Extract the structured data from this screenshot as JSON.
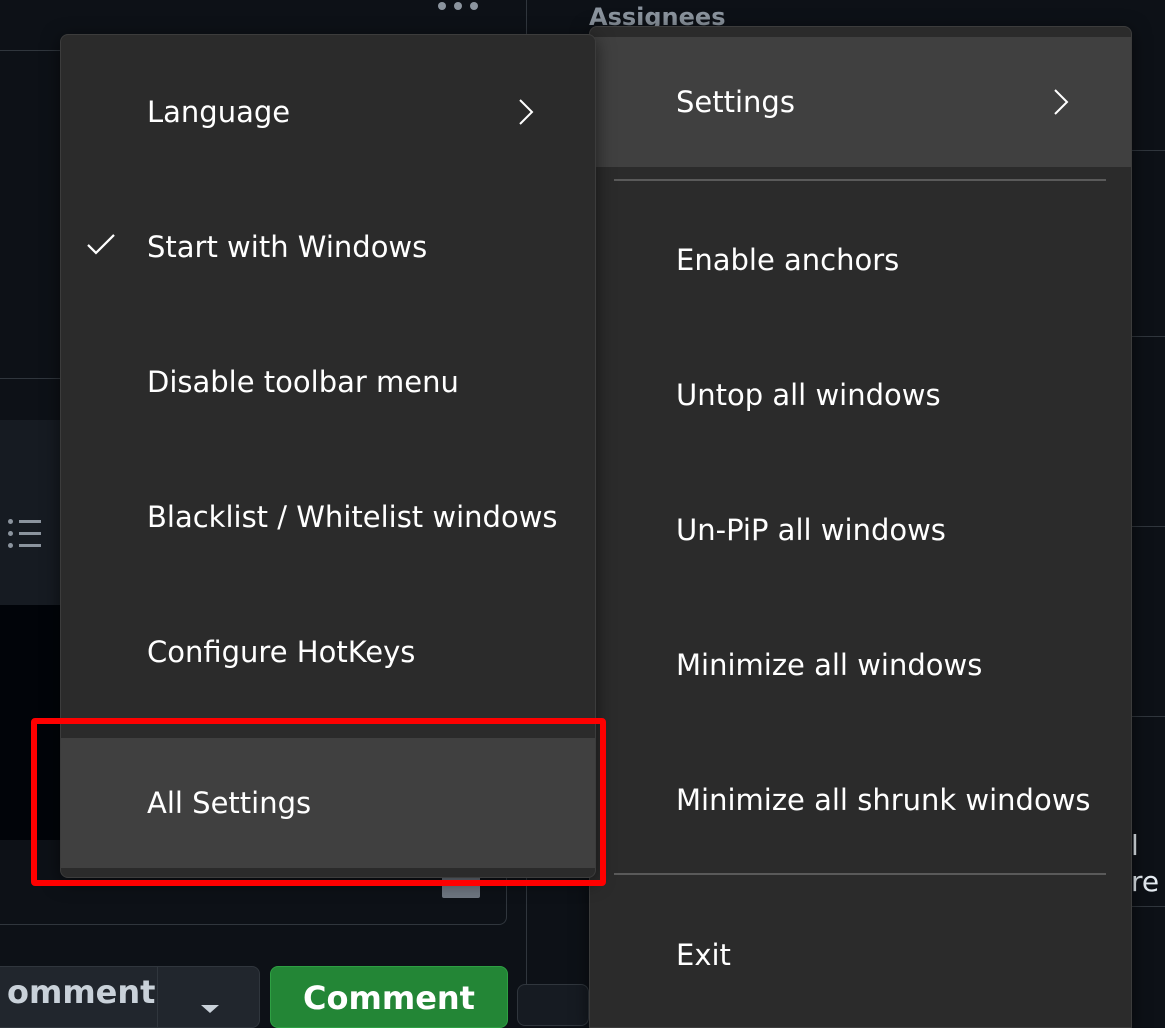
{
  "background": {
    "assignees_label": "Assignees",
    "close_comment_label": "omment",
    "comment_button_label": "Comment",
    "right_fragment": "l re"
  },
  "left_menu": {
    "items": [
      {
        "label": "Language",
        "has_submenu": true
      },
      {
        "label": "Start with Windows",
        "checked": true
      },
      {
        "label": "Disable toolbar menu"
      },
      {
        "label": "Blacklist / Whitelist windows"
      },
      {
        "label": "Configure HotKeys"
      },
      {
        "label": "All Settings",
        "highlighted": true
      }
    ]
  },
  "right_menu": {
    "items": [
      {
        "label": "Settings",
        "has_submenu": true,
        "highlighted": true
      },
      {
        "label": "Enable anchors"
      },
      {
        "label": "Untop all windows"
      },
      {
        "label": "Un-PiP all windows"
      },
      {
        "label": "Minimize all windows"
      },
      {
        "label": "Minimize all shrunk windows"
      },
      {
        "label": "Exit"
      }
    ]
  },
  "annotation": {
    "highlight_color": "#ff0000",
    "target": "All Settings"
  },
  "colors": {
    "menu_bg": "#2b2b2b",
    "menu_highlight": "#404040",
    "page_bg": "#0d1117",
    "comment_button": "#238636"
  },
  "icons": [
    "check-icon",
    "chevron-right-icon",
    "kebab-menu-icon",
    "list-icon",
    "markdown-icon",
    "caret-down-icon"
  ]
}
